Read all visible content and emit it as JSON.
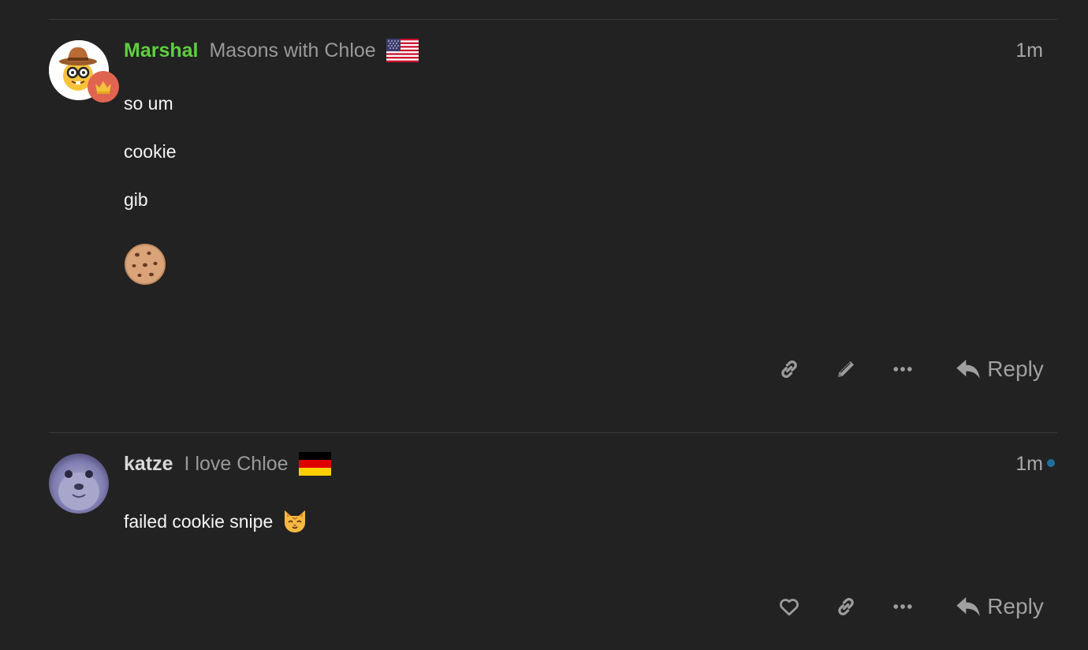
{
  "posts": [
    {
      "username": "Marshal",
      "username_color": "#5fcf3f",
      "user_title": "Masons with Chloe",
      "flag_icon": "us-flag-icon",
      "avatar_icon": "cowboy-nerd-avatar",
      "flair_icon": "crown-icon",
      "date": "1m",
      "paragraphs": [
        "so um",
        "cookie",
        "gib"
      ],
      "emoji_icon": "cookie-emoji-icon",
      "actions": [
        "link-icon",
        "pencil-icon",
        "more-icon"
      ],
      "reply_label": "Reply"
    },
    {
      "username": "katze",
      "username_color": "#d8d8d8",
      "user_title": "I love Chloe",
      "flag_icon": "germany-flag-icon",
      "avatar_icon": "seal-avatar",
      "date": "1m",
      "paragraphs": [
        "failed cookie snipe"
      ],
      "emoji_icon": "cat-face-emoji-icon",
      "actions": [
        "heart-icon",
        "link-icon",
        "more-icon"
      ],
      "reply_label": "Reply"
    }
  ]
}
